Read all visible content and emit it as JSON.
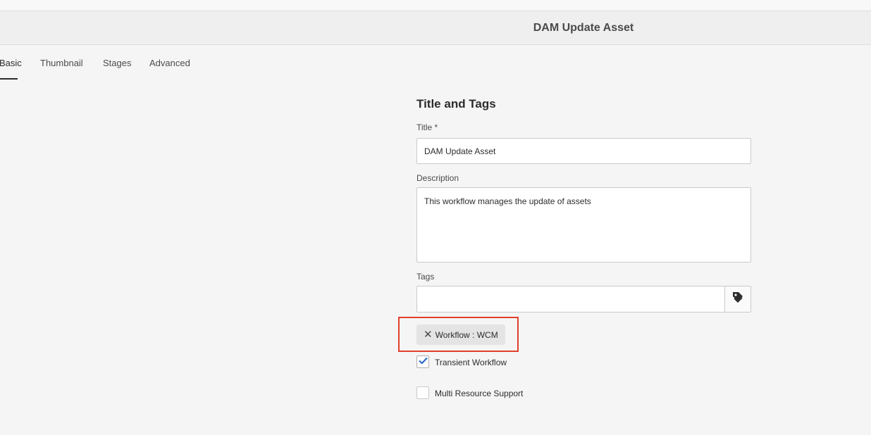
{
  "window": {
    "title": "DAM Update Asset"
  },
  "tabs": [
    {
      "label": "Basic"
    },
    {
      "label": "Thumbnail"
    },
    {
      "label": "Stages"
    },
    {
      "label": "Advanced"
    }
  ],
  "form": {
    "section_heading": "Title and Tags",
    "title_label": "Title *",
    "title_value": "DAM Update Asset",
    "description_label": "Description",
    "description_value": "This workflow manages the update of assets",
    "tags_label": "Tags",
    "tags_value": "",
    "tag_chips": [
      {
        "label": "Workflow : WCM",
        "remove_icon": "close-icon"
      }
    ],
    "transient_label": "Transient Workflow",
    "transient_checked": true,
    "multi_resource_label": "Multi Resource Support",
    "multi_resource_checked": false
  },
  "icons": {
    "tag_picker": "tag-icon",
    "checkmark": "checkmark-icon"
  },
  "colors": {
    "highlight": "#e0402a",
    "checkbox_accent": "#2b6cc4"
  }
}
